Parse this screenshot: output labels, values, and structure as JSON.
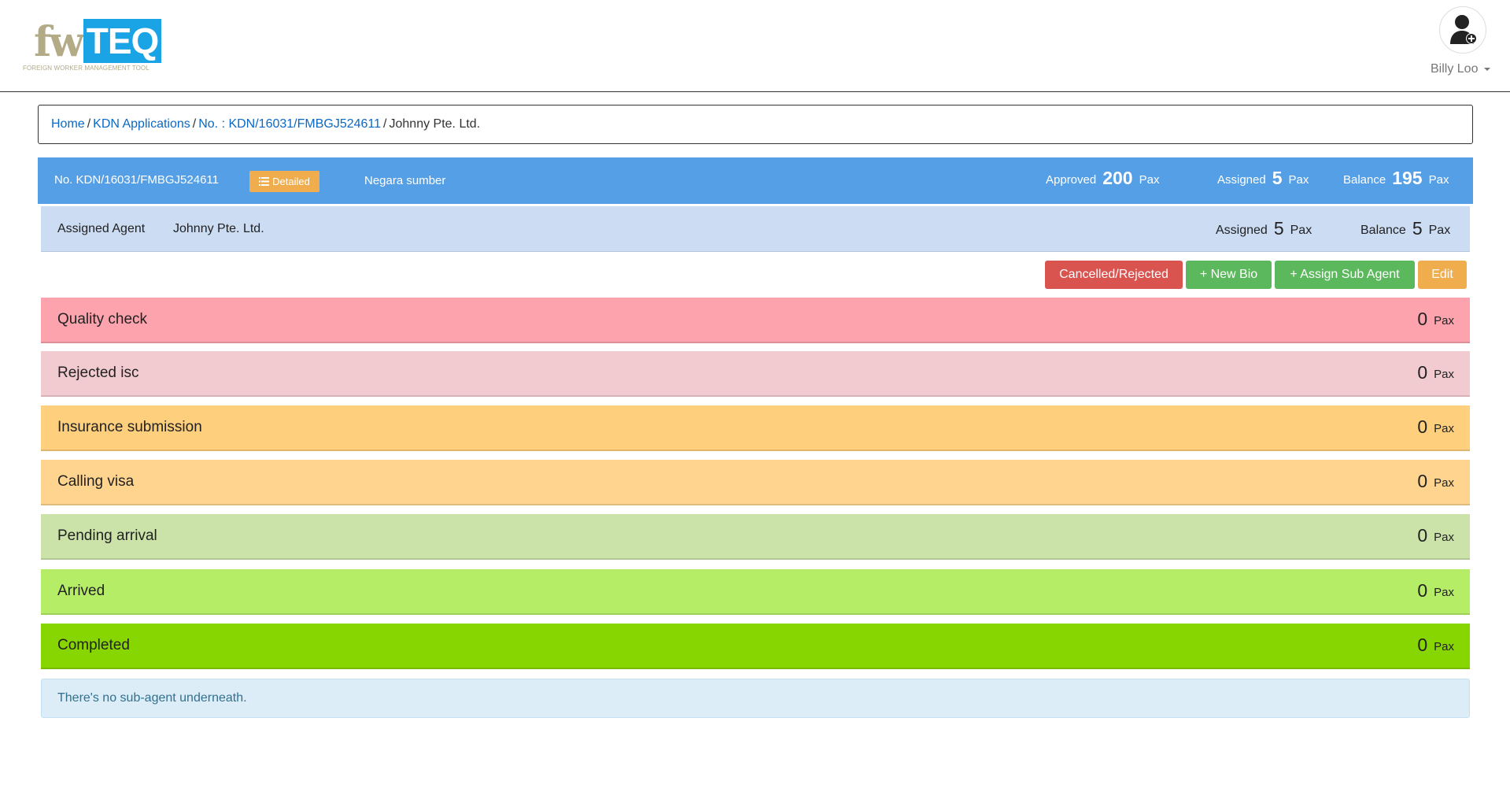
{
  "header": {
    "logo": {
      "part1": "fw",
      "part2": "TEQ",
      "tagline": "FOREIGN WORKER MANAGEMENT TOOL"
    },
    "user": {
      "name": "Billy Loo"
    }
  },
  "breadcrumb": {
    "items": [
      "Home",
      "KDN Applications",
      "No. : KDN/16031/FMBGJ524611"
    ],
    "current": "Johnny Pte. Ltd."
  },
  "application": {
    "number": "No. KDN/16031/FMBGJ524611",
    "detailed_label": "Detailed",
    "source_country": "Negara sumber",
    "approved_label": "Approved",
    "approved_value": "200",
    "assigned_label": "Assigned",
    "assigned_value": "5",
    "balance_label": "Balance",
    "balance_value": "195",
    "unit": "Pax"
  },
  "agent": {
    "label": "Assigned Agent",
    "name": "Johnny Pte. Ltd.",
    "assigned_label": "Assigned",
    "assigned_value": "5",
    "balance_label": "Balance",
    "balance_value": "5",
    "unit": "Pax"
  },
  "actions": {
    "cancelled": "Cancelled/Rejected",
    "new_bio": "+ New Bio",
    "assign_sub_agent": "+ Assign Sub Agent",
    "edit": "Edit"
  },
  "statuses": [
    {
      "title": "Quality check",
      "count": "0",
      "unit": "Pax",
      "color": "#fca3ad"
    },
    {
      "title": "Rejected isc",
      "count": "0",
      "unit": "Pax",
      "color": "#f2cbd1"
    },
    {
      "title": "Insurance submission",
      "count": "0",
      "unit": "Pax",
      "color": "#fecf7c"
    },
    {
      "title": "Calling visa",
      "count": "0",
      "unit": "Pax",
      "color": "#fed48f"
    },
    {
      "title": "Pending arrival",
      "count": "0",
      "unit": "Pax",
      "color": "#cbe3a9"
    },
    {
      "title": "Arrived",
      "count": "0",
      "unit": "Pax",
      "color": "#b6ed67"
    },
    {
      "title": "Completed",
      "count": "0",
      "unit": "Pax",
      "color": "#88d601"
    }
  ],
  "sub_agent_message": "There's no sub-agent underneath."
}
